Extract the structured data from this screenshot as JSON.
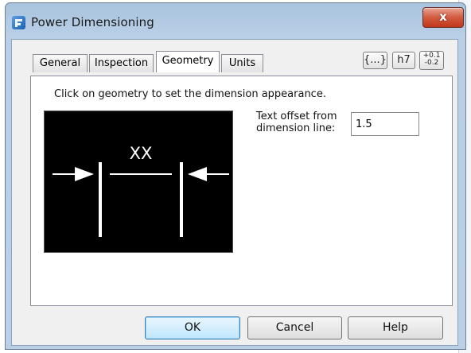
{
  "window": {
    "title": "Power Dimensioning",
    "close_symbol": "x"
  },
  "tabs": [
    {
      "label": "General",
      "active": false
    },
    {
      "label": "Inspection",
      "active": false
    },
    {
      "label": "Geometry",
      "active": true
    },
    {
      "label": "Units",
      "active": false
    }
  ],
  "toolbar": {
    "text_format_label": "{...}",
    "fit_label": "h7",
    "tolerance_upper": "+0.1",
    "tolerance_lower": "-0.2"
  },
  "geometry": {
    "instruction": "Click on geometry to set the dimension appearance.",
    "preview_text": "XX",
    "offset_label_line1": "Text offset from",
    "offset_label_line2": "dimension line:",
    "offset_value": "1.5"
  },
  "buttons": {
    "ok": "OK",
    "cancel": "Cancel",
    "help": "Help"
  },
  "colors": {
    "preview_background": "#000000",
    "preview_lines": "#ffffff",
    "default_button": "#bee6fd"
  }
}
